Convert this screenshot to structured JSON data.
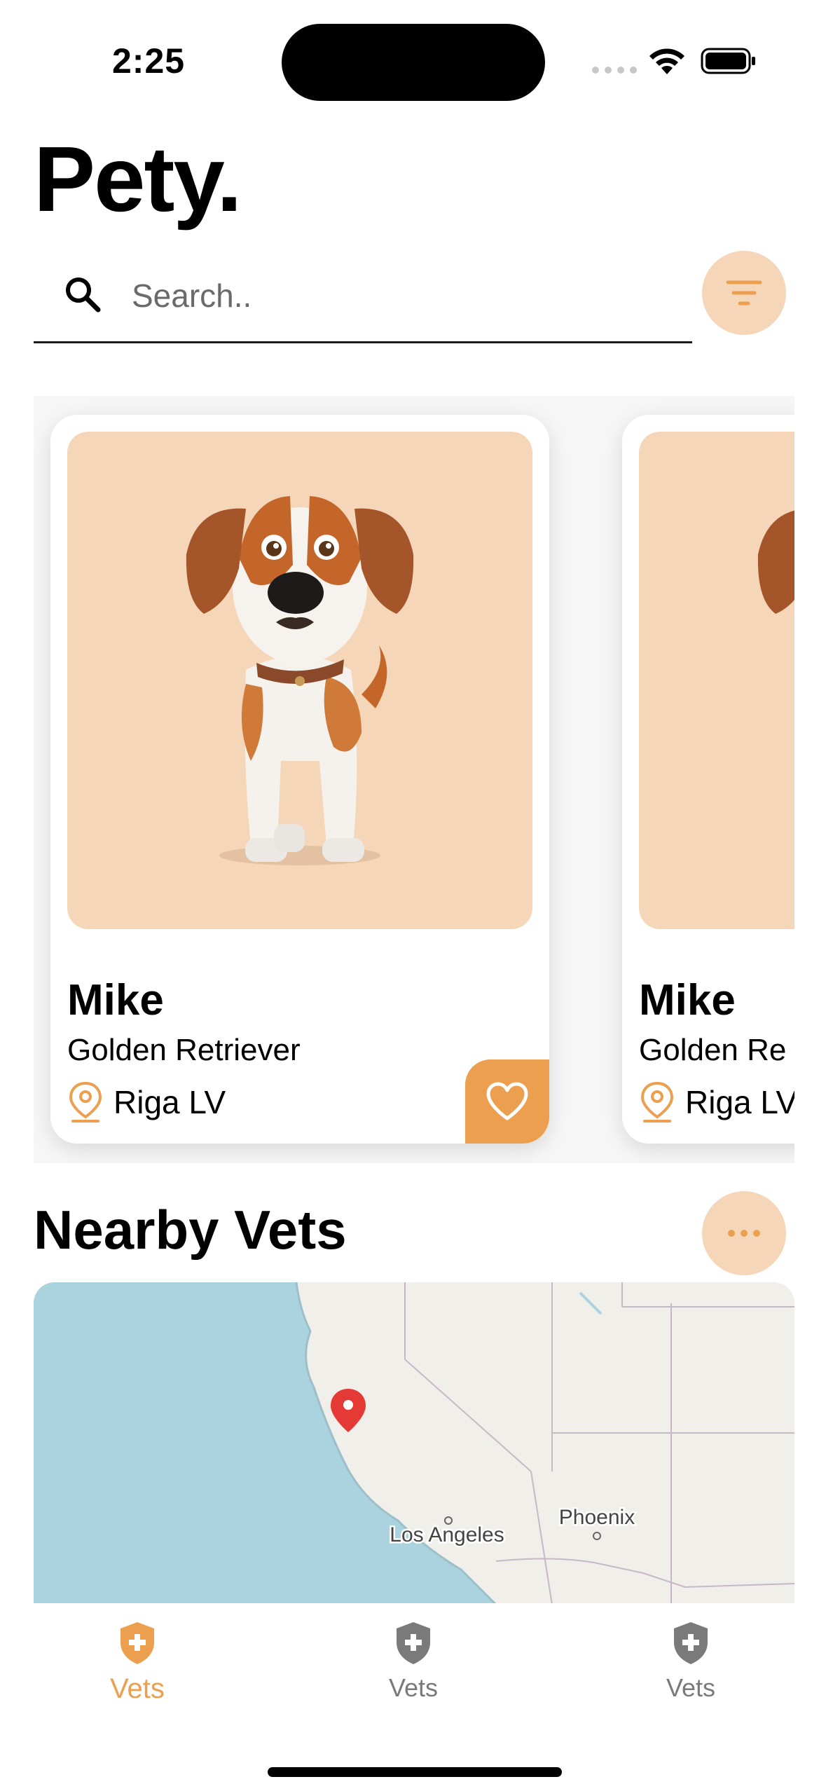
{
  "status_bar": {
    "time": "2:25"
  },
  "app": {
    "title": "Pety."
  },
  "search": {
    "placeholder": "Search.."
  },
  "pets": [
    {
      "name": "Mike",
      "breed": "Golden Retriever",
      "location": "Riga LV"
    },
    {
      "name": "Mike",
      "breed": "Golden Re",
      "location": "Riga LV"
    }
  ],
  "nearby": {
    "title": "Nearby Vets",
    "map_labels": {
      "city1": "Los Angeles",
      "city2": "Phoenix"
    }
  },
  "tabs": [
    {
      "label": "Vets",
      "active": true
    },
    {
      "label": "Vets",
      "active": false
    },
    {
      "label": "Vets",
      "active": false
    }
  ],
  "colors": {
    "accent": "#ec9f4f",
    "accent_soft": "#f6d6b8",
    "water": "#aad3df",
    "land": "#f1efe9",
    "pin": "#e53935"
  },
  "icons": [
    "search-icon",
    "filter-icon",
    "location-pin-icon",
    "heart-icon",
    "more-icon",
    "map-marker-icon",
    "vet-shield-icon"
  ]
}
